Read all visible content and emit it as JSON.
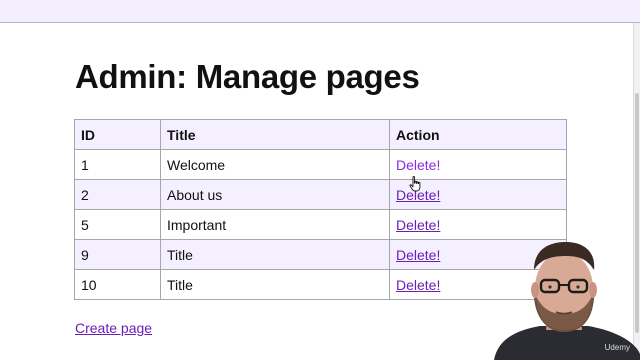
{
  "page": {
    "title": "Admin: Manage pages",
    "create_link": "Create page"
  },
  "table": {
    "headers": [
      "ID",
      "Title",
      "Action"
    ],
    "rows": [
      {
        "id": "1",
        "title": "Welcome",
        "action": "Delete!"
      },
      {
        "id": "2",
        "title": "About us",
        "action": "Delete!"
      },
      {
        "id": "5",
        "title": "Important",
        "action": "Delete!"
      },
      {
        "id": "9",
        "title": "Title",
        "action": "Delete!"
      },
      {
        "id": "10",
        "title": "Title",
        "action": "Delete!"
      }
    ]
  },
  "overlay": {
    "watermark": "Udemy"
  },
  "colors": {
    "topbar": "#f4efff",
    "row_shade": "#f5f0ff",
    "link": "#6a1fb5"
  }
}
